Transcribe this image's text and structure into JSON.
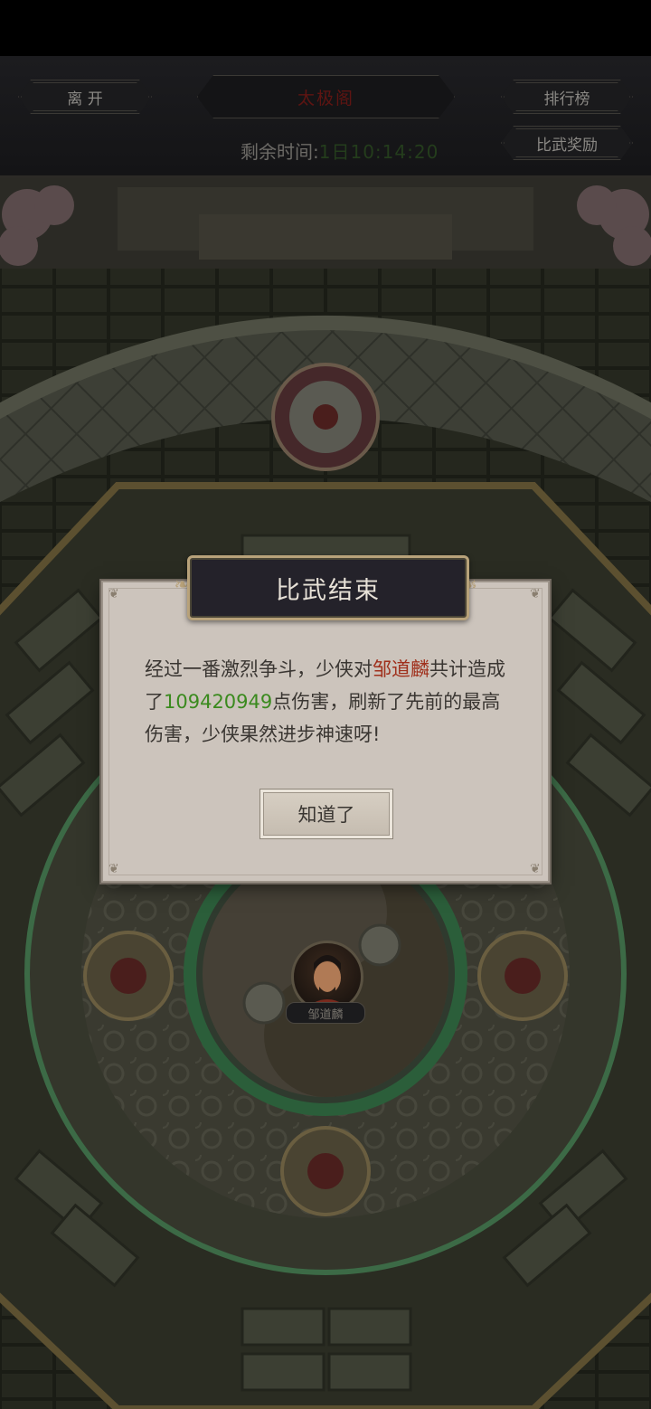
{
  "header": {
    "leave_label": "离 开",
    "arena_title": "太极阁",
    "ranking_label": "排行榜",
    "reward_label": "比武奖励",
    "timer_label": "剩余时间:",
    "timer_value": "1日10:14:20"
  },
  "dialog": {
    "title": "比武结束",
    "text_part1": "经过一番激烈争斗，少侠对",
    "opponent_name": "邹道麟",
    "text_part2": "共计造成了",
    "damage_value": "109420949",
    "text_part3": "点伤害，刷新了先前的最高伤害，少侠果然进步神速呀!",
    "ok_label": "知道了"
  },
  "arena": {
    "player_name": "邹道麟"
  },
  "colors": {
    "opponent_name": "#a0301c",
    "damage_value": "#3a8a1e",
    "dialog_bg": "#ccc4bc",
    "header_bg": "#24222a",
    "header_border": "#b8a27a"
  }
}
